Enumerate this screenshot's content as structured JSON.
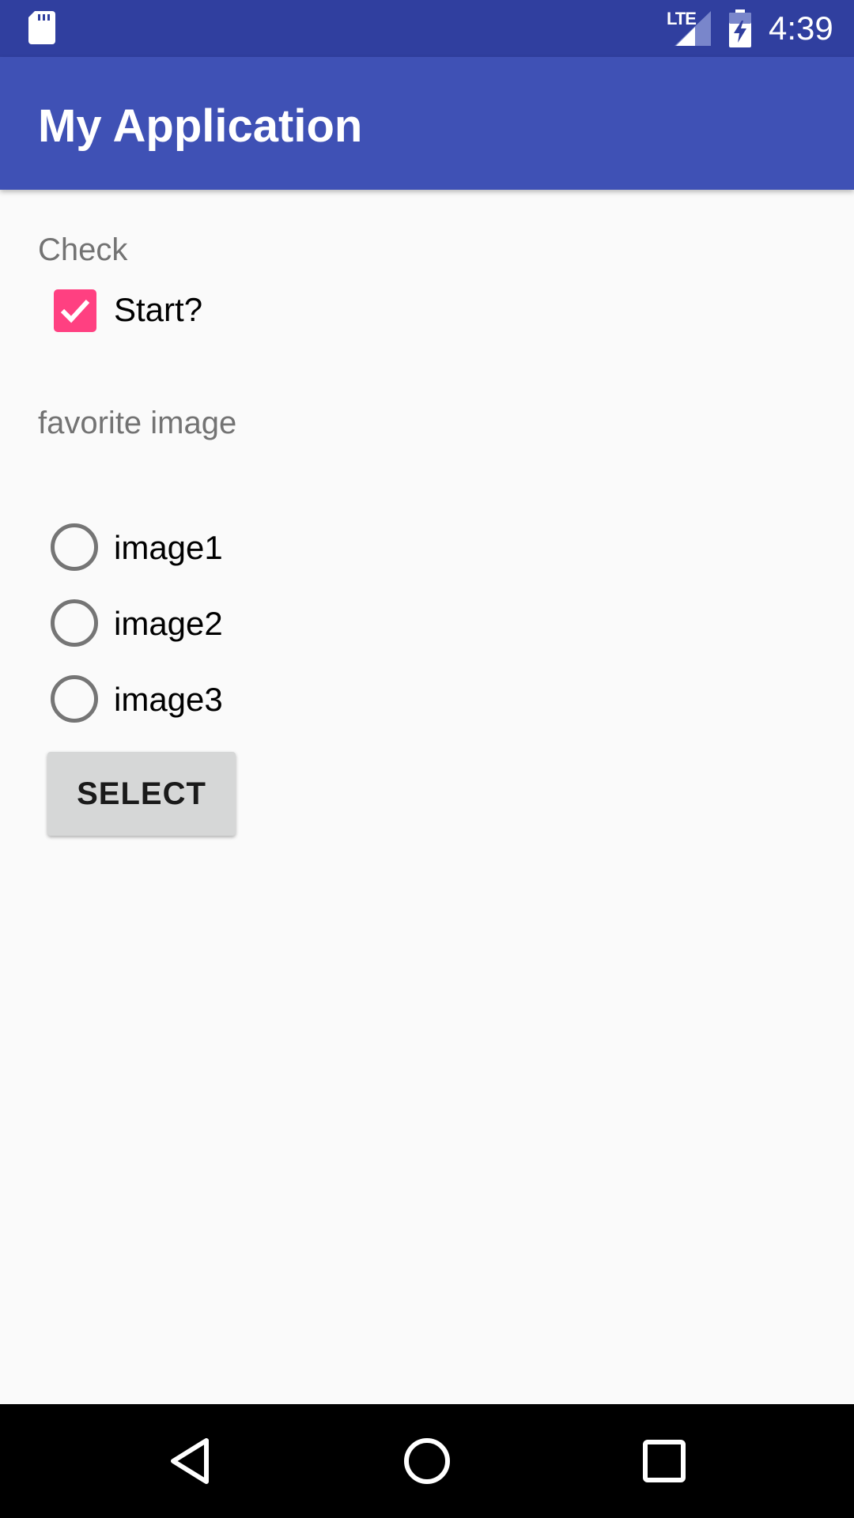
{
  "status_bar": {
    "network": "LTE",
    "time": "4:39",
    "icons": [
      "sd-card-icon",
      "signal-icon",
      "battery-charging-icon"
    ]
  },
  "app_bar": {
    "title": "My Application"
  },
  "main": {
    "check_label": "Check",
    "checkbox": {
      "label": "Start?",
      "checked": true
    },
    "radio_group_label": "favorite image",
    "radio_options": [
      {
        "label": "image1",
        "selected": false
      },
      {
        "label": "image2",
        "selected": false
      },
      {
        "label": "image3",
        "selected": false
      }
    ],
    "select_button": "SELECT"
  },
  "nav_bar": {
    "icons": [
      "back-icon",
      "home-icon",
      "recents-icon"
    ]
  },
  "colors": {
    "status_bar": "#303f9f",
    "app_bar": "#3f51b5",
    "accent": "#ff4081",
    "background": "#fafafa"
  }
}
